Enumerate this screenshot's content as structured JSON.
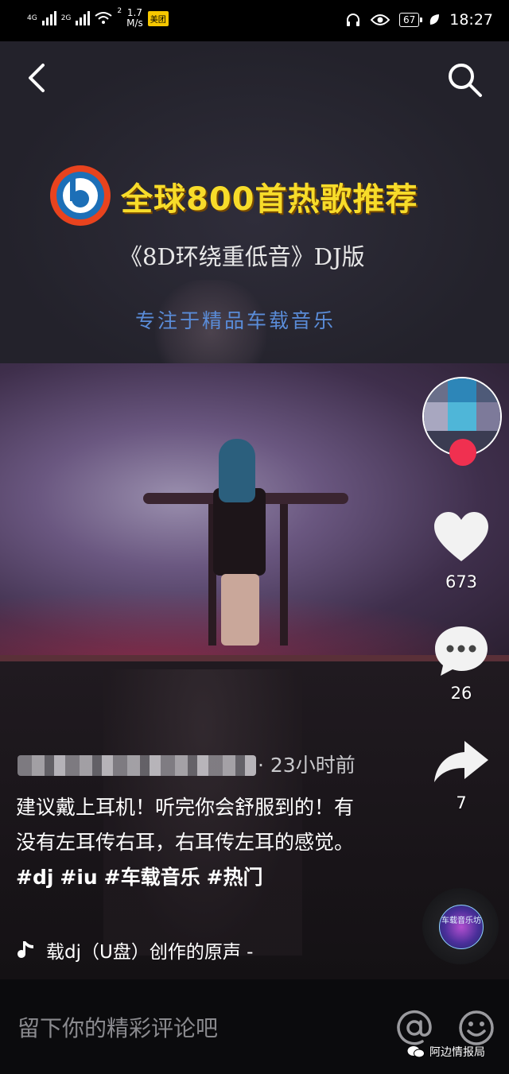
{
  "status_bar": {
    "network_1": "4G",
    "network_2": "2G",
    "wifi_badge": "2",
    "speed": "1.7",
    "speed_unit": "M/s",
    "app_badge": "美团",
    "battery": "67",
    "time": "18:27"
  },
  "video_overlay": {
    "title": "全球800首热歌推荐",
    "subtitle": "《8D环绕重低音》DJ版",
    "slogan": "专注于精品车载音乐"
  },
  "rail": {
    "likes": "673",
    "comments": "26",
    "shares": "7"
  },
  "post": {
    "time_ago": "· 23小时前",
    "caption_text": "建议戴上耳机！听完你会舒服到的！有没有左耳传右耳，右耳传左耳的感觉。",
    "hashtags": [
      "#dj",
      "#iu",
      "#车载音乐",
      "#热门"
    ],
    "sound": "载dj（U盘）创作的原声 -",
    "disc_label": "车载音乐坊"
  },
  "comment_bar": {
    "placeholder": "留下你的精彩评论吧"
  },
  "watermark": "阿边情报局",
  "colors": {
    "accent_red": "#f03050",
    "title_yellow": "#f7dc2a",
    "slogan_blue": "#5a8cd8"
  }
}
